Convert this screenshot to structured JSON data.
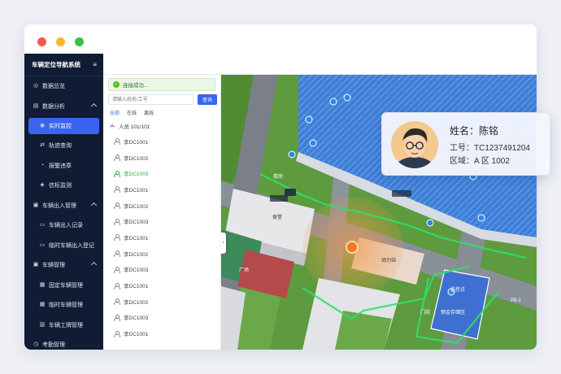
{
  "app": {
    "title": "车辆定位导航系统"
  },
  "sidebar": {
    "items": [
      {
        "label": "数据总览",
        "level": 0,
        "icon": "dashboard-icon"
      },
      {
        "label": "数据分析",
        "level": 0,
        "icon": "chart-icon",
        "expanded": true
      },
      {
        "label": "实时监控",
        "level": 1,
        "icon": "monitor-icon",
        "active": true
      },
      {
        "label": "轨迹查询",
        "level": 1,
        "icon": "route-icon"
      },
      {
        "label": "报警违章",
        "level": 1,
        "icon": "alarm-icon"
      },
      {
        "label": "信标监测",
        "level": 1,
        "icon": "beacon-icon"
      },
      {
        "label": "车辆出入管理",
        "level": 0,
        "icon": "car-icon",
        "expanded": true
      },
      {
        "label": "车辆出入记录",
        "level": 1,
        "icon": "record-icon"
      },
      {
        "label": "临时车辆出入登记",
        "level": 1,
        "icon": "register-icon"
      },
      {
        "label": "车辆管理",
        "level": 0,
        "icon": "car-manage-icon",
        "expanded": true
      },
      {
        "label": "固定车辆管理",
        "level": 1,
        "icon": "fixed-car-icon"
      },
      {
        "label": "临时车辆管理",
        "level": 1,
        "icon": "temp-car-icon"
      },
      {
        "label": "车辆工牌管理",
        "level": 1,
        "icon": "badge-icon"
      },
      {
        "label": "考勤管理",
        "level": 0,
        "icon": "attendance-icon"
      }
    ]
  },
  "panel": {
    "toast": "连接成功...",
    "search_placeholder": "请输入姓名/工号",
    "search_button": "查询",
    "filters": [
      "全部",
      "在线",
      "离线"
    ],
    "group_label": "人员 101/101",
    "people": [
      "李DC1001",
      "李DC1002",
      "李DC1003",
      "李DC1001",
      "李DC1002",
      "李DC1003",
      "李DC1001",
      "李DC1002",
      "李DC1003",
      "李DC1001",
      "李DC1002",
      "李DC1003",
      "李DC1001"
    ],
    "highlighted_index": 2
  },
  "map": {
    "labels": {
      "canteen": "食堂",
      "power_station": "动力站",
      "plaza": "广场",
      "monitor_point": "监控点",
      "steel_area": "钢金存储区",
      "road_tag": "P8-1",
      "building_tag": "楼房",
      "gate": "门岗"
    },
    "accent": "#35c24a"
  },
  "card": {
    "name": "姓名：陈铭",
    "work_id": "工号：TC1237491204",
    "area": "区域：A 区 1002"
  }
}
